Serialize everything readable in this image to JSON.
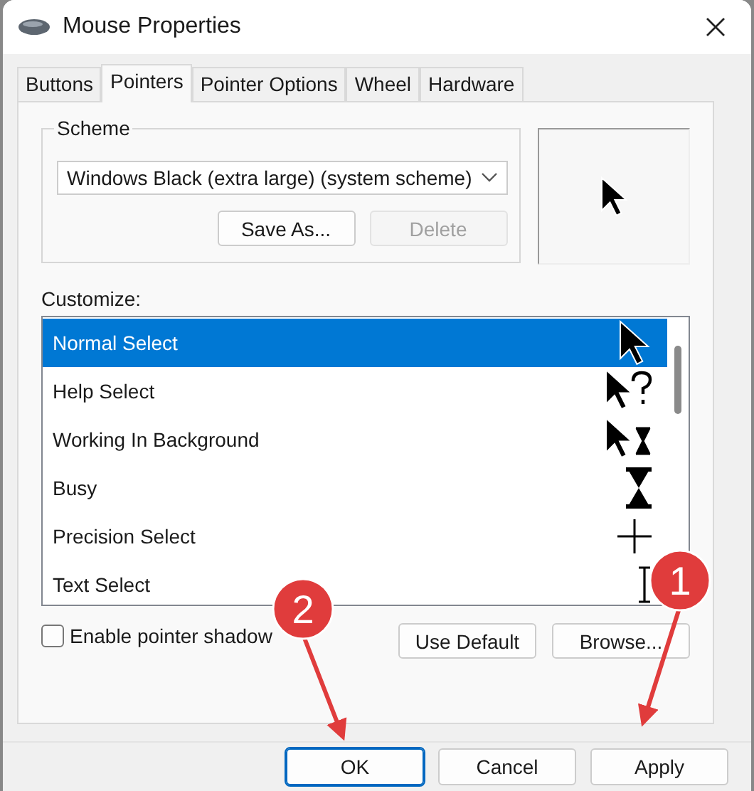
{
  "window": {
    "title": "Mouse Properties"
  },
  "tabs": [
    {
      "label": "Buttons",
      "selected": false
    },
    {
      "label": "Pointers",
      "selected": true
    },
    {
      "label": "Pointer Options",
      "selected": false
    },
    {
      "label": "Wheel",
      "selected": false
    },
    {
      "label": "Hardware",
      "selected": false
    }
  ],
  "scheme": {
    "label": "Scheme",
    "value": "Windows Black (extra large) (system scheme)",
    "buttons": [
      {
        "label": "Save As...",
        "disabled": false
      },
      {
        "label": "Delete",
        "disabled": true
      }
    ]
  },
  "customize": {
    "label": "Customize:",
    "items": [
      {
        "name": "Normal Select",
        "selected": true
      },
      {
        "name": "Help Select",
        "selected": false
      },
      {
        "name": "Working In Background",
        "selected": false
      },
      {
        "name": "Busy",
        "selected": false
      },
      {
        "name": "Precision Select",
        "selected": false
      },
      {
        "name": "Text Select",
        "selected": false
      }
    ]
  },
  "pointer_shadow": {
    "label": "Enable pointer shadow",
    "checked": false
  },
  "list_buttons": [
    "Use Default",
    "Browse..."
  ],
  "dialog_buttons": [
    {
      "label": "OK",
      "selected": true
    },
    {
      "label": "Cancel",
      "selected": false
    },
    {
      "label": "Apply",
      "selected": false
    }
  ],
  "callouts": [
    {
      "number": "1"
    },
    {
      "number": "2"
    }
  ]
}
